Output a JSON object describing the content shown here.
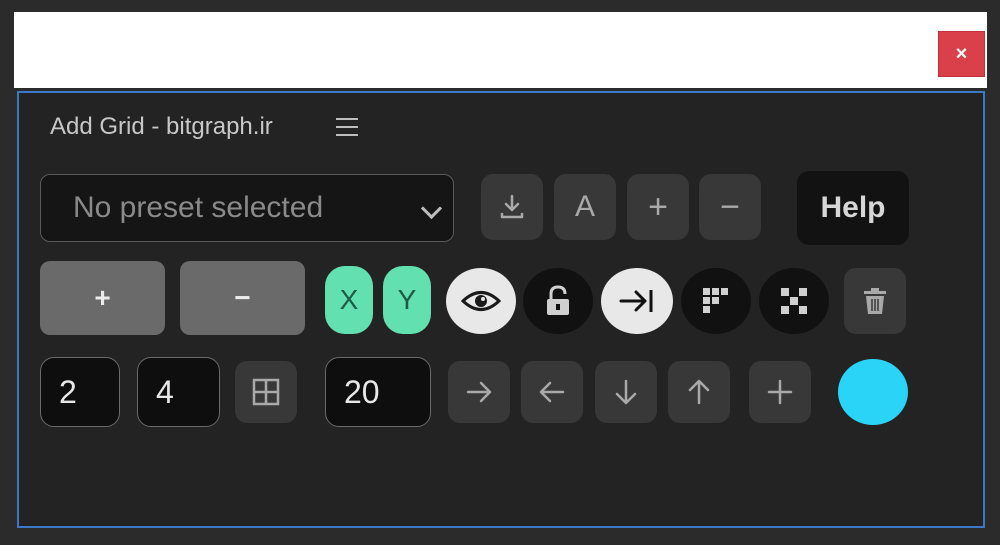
{
  "window": {
    "close_label": "×"
  },
  "panel": {
    "title": "Add Grid - bitgraph.ir"
  },
  "preset": {
    "selected": "No preset selected"
  },
  "toolbar1": {
    "download_icon": "download-icon",
    "a_label": "A",
    "add_label": "+",
    "remove_label": "−",
    "help_label": "Help"
  },
  "toolbar2": {
    "add_grid_label": "+",
    "remove_grid_label": "−",
    "x_label": "X",
    "y_label": "Y"
  },
  "fields": {
    "columns": "2",
    "rows": "4",
    "gutter": "20"
  },
  "colors": {
    "accent_green": "#63e0b0",
    "swatch": "#29d4f7",
    "close_red": "#d9404a",
    "panel_border": "#3b78c7"
  }
}
